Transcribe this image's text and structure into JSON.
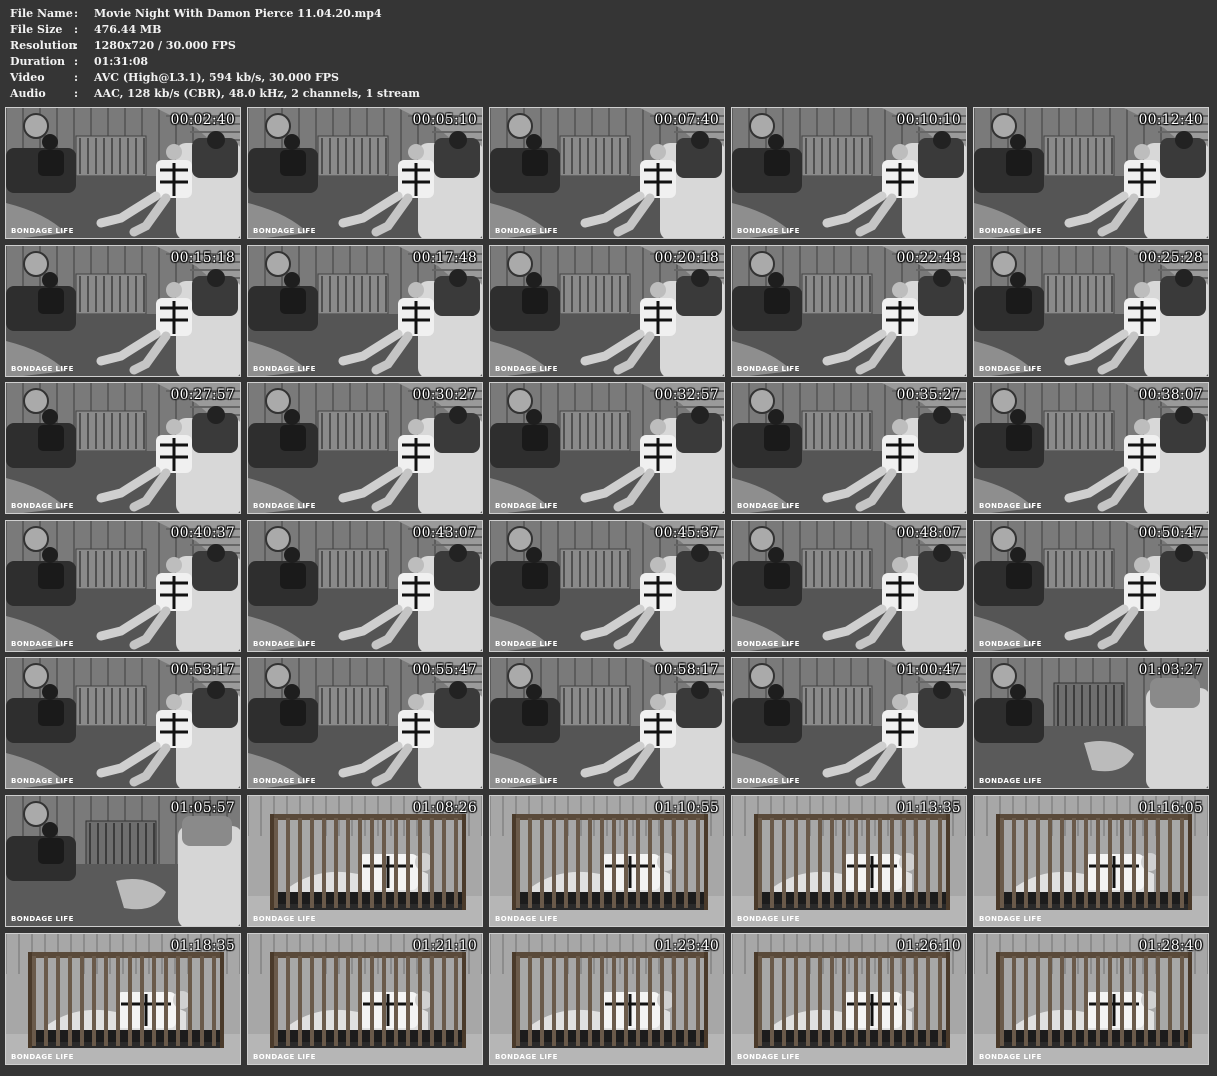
{
  "info": [
    {
      "key": "File Name",
      "sep": ":",
      "value": "Movie Night With Damon Pierce 11.04.20.mp4"
    },
    {
      "key": "File Size",
      "sep": ":",
      "value": "476.44 MB"
    },
    {
      "key": "Resolution",
      "sep": ":",
      "value": "1280x720 / 30.000 FPS"
    },
    {
      "key": "Duration",
      "sep": ":",
      "value": "01:31:08"
    },
    {
      "key": "Video",
      "sep": ":",
      "value": "AVC (High@L3.1), 594 kb/s, 30.000 FPS"
    },
    {
      "key": "Audio",
      "sep": ":",
      "value": "AAC, 128 kb/s (CBR), 48.0 kHz, 2 channels, 1 stream"
    }
  ],
  "watermark": "BONDAGE LIFE",
  "thumbnails": [
    {
      "time": "00:02:40",
      "scene": "living"
    },
    {
      "time": "00:05:10",
      "scene": "living"
    },
    {
      "time": "00:07:40",
      "scene": "living"
    },
    {
      "time": "00:10:10",
      "scene": "living"
    },
    {
      "time": "00:12:40",
      "scene": "living"
    },
    {
      "time": "00:15:18",
      "scene": "living"
    },
    {
      "time": "00:17:48",
      "scene": "living"
    },
    {
      "time": "00:20:18",
      "scene": "living"
    },
    {
      "time": "00:22:48",
      "scene": "living"
    },
    {
      "time": "00:25:28",
      "scene": "living"
    },
    {
      "time": "00:27:57",
      "scene": "living"
    },
    {
      "time": "00:30:27",
      "scene": "living"
    },
    {
      "time": "00:32:57",
      "scene": "living"
    },
    {
      "time": "00:35:27",
      "scene": "living"
    },
    {
      "time": "00:38:07",
      "scene": "living"
    },
    {
      "time": "00:40:37",
      "scene": "living"
    },
    {
      "time": "00:43:07",
      "scene": "living"
    },
    {
      "time": "00:45:37",
      "scene": "living"
    },
    {
      "time": "00:48:07",
      "scene": "living"
    },
    {
      "time": "00:50:47",
      "scene": "living"
    },
    {
      "time": "00:53:17",
      "scene": "living"
    },
    {
      "time": "00:55:47",
      "scene": "living"
    },
    {
      "time": "00:58:17",
      "scene": "living"
    },
    {
      "time": "01:00:47",
      "scene": "living"
    },
    {
      "time": "01:03:27",
      "scene": "room"
    },
    {
      "time": "01:05:57",
      "scene": "room"
    },
    {
      "time": "01:08:26",
      "scene": "cage"
    },
    {
      "time": "01:10:55",
      "scene": "cage"
    },
    {
      "time": "01:13:35",
      "scene": "cage"
    },
    {
      "time": "01:16:05",
      "scene": "cage"
    },
    {
      "time": "01:18:35",
      "scene": "cage"
    },
    {
      "time": "01:21:10",
      "scene": "cage"
    },
    {
      "time": "01:23:40",
      "scene": "cage"
    },
    {
      "time": "01:26:10",
      "scene": "cage"
    },
    {
      "time": "01:28:40",
      "scene": "cage"
    }
  ]
}
